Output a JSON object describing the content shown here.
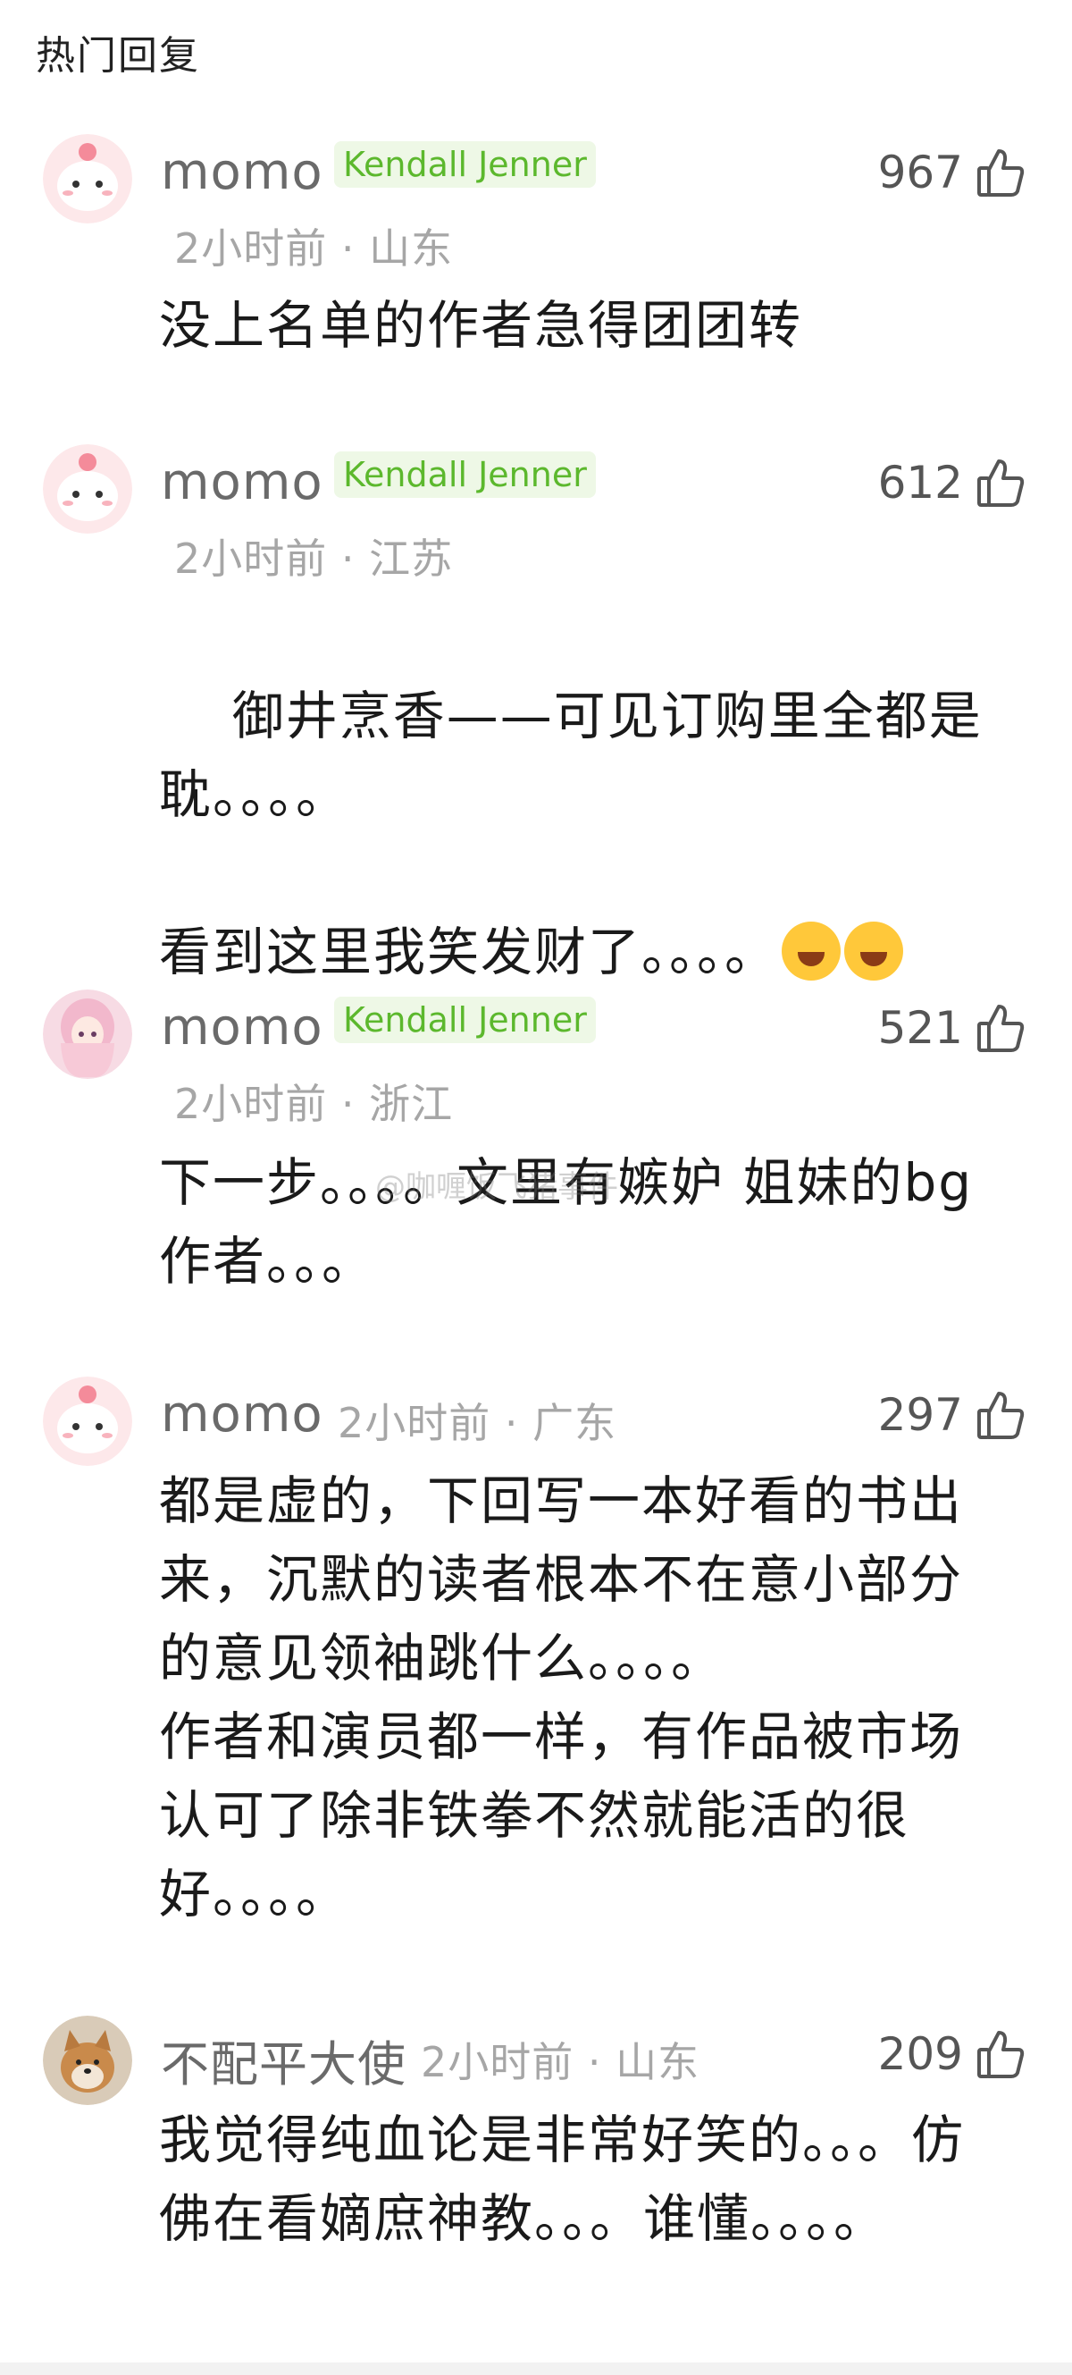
{
  "section_title": "热门回复",
  "watermark": "@咖喱饭飞猪事件",
  "colors": {
    "badge_text": "#5cb82d",
    "badge_bg": "#eef8e6",
    "meta": "#a6a6a6",
    "username": "#6a6a6a"
  },
  "comments": [
    {
      "avatar": "pink-dino-avatar",
      "username": "momo",
      "badge": "Kendall Jenner",
      "time": "2小时前",
      "location": "山东",
      "likes": "967",
      "text": "没上名单的作者急得团团转"
    },
    {
      "avatar": "pink-dino-avatar",
      "username": "momo",
      "badge": "Kendall Jenner",
      "time": "2小时前",
      "location": "江苏",
      "likes": "612",
      "text": "御井烹香——可见订购里全都是耽。。。。\n\n看到这里我笑发财了。。。。",
      "emojis": [
        "laughing-tears-emoji",
        "rolling-laughing-emoji"
      ]
    },
    {
      "avatar": "anime-girl-avatar",
      "username": "momo",
      "badge": "Kendall Jenner",
      "time": "2小时前",
      "location": "浙江",
      "likes": "521",
      "text": "下一步。。。。文里有嫉妒 姐妹的bg作者。。。"
    },
    {
      "avatar": "pink-dino-avatar",
      "username": "momo",
      "time": "2小时前",
      "location": "广东",
      "likes": "297",
      "text": "都是虚的，下回写一本好看的书出来，沉默的读者根本不在意小部分的意见领袖跳什么。。。。\n作者和演员都一样，有作品被市场认可了除非铁拳不然就能活的很好。。。。"
    },
    {
      "avatar": "shiba-dog-avatar",
      "username": "不配平大使",
      "time": "2小时前",
      "location": "山东",
      "likes": "209",
      "text": "我觉得纯血论是非常好笑的。。。仿佛在看嫡庶神教。。。谁懂。。。。"
    }
  ],
  "separator": "·"
}
